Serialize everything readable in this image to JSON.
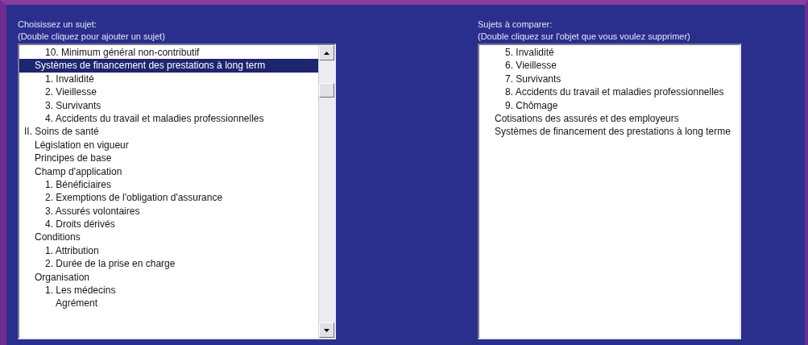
{
  "panels": [
    {
      "title": "Choisissez un sujet:",
      "hint": "(Double cliquez pour ajouter un sujet)",
      "scrollbar": true,
      "items": [
        {
          "children": [
            {
              "children": [
                {
                  "label": "10. Minimum général non-contributif",
                  "selected": false
                }
              ]
            },
            {
              "label": "Systèmes de financement des prestations à long term",
              "selected": true,
              "children": [
                {
                  "label": "1. Invalidité",
                  "selected": false
                },
                {
                  "label": "2. Vieillesse",
                  "selected": false
                },
                {
                  "label": "3. Survivants",
                  "selected": false
                },
                {
                  "label": "4. Accidents du travail et maladies professionnelles",
                  "selected": false
                }
              ]
            }
          ]
        },
        {
          "label": "II. Soins de santé",
          "selected": false,
          "children": [
            {
              "label": "Législation en vigueur",
              "selected": false
            },
            {
              "label": "Principes de base",
              "selected": false
            },
            {
              "label": "Champ d'application",
              "selected": false,
              "children": [
                {
                  "label": "1. Bénéficiaires",
                  "selected": false
                },
                {
                  "label": "2. Exemptions de l'obligation d'assurance",
                  "selected": false
                },
                {
                  "label": "3. Assurés volontaires",
                  "selected": false
                },
                {
                  "label": "4. Droits dérivés",
                  "selected": false
                }
              ]
            },
            {
              "label": "Conditions",
              "selected": false,
              "children": [
                {
                  "label": "1. Attribution",
                  "selected": false
                },
                {
                  "label": "2. Durée de la prise en charge",
                  "selected": false
                }
              ]
            },
            {
              "label": "Organisation",
              "selected": false,
              "children": [
                {
                  "label": "1. Les médecins",
                  "selected": false,
                  "children": [
                    {
                      "label": "Agrément",
                      "selected": false
                    }
                  ]
                }
              ]
            }
          ]
        }
      ]
    },
    {
      "title": "Sujets à comparer:",
      "hint": "(Double cliquez sur l'objet que vous voulez supprimer)",
      "scrollbar": false,
      "items": [
        {
          "children": [
            {
              "children": [
                {
                  "label": "5. Invalidité",
                  "selected": false
                },
                {
                  "label": "6. Vieillesse",
                  "selected": false
                },
                {
                  "label": "7. Survivants",
                  "selected": false
                },
                {
                  "label": "8. Accidents du travail et maladies professionnelles",
                  "selected": false
                },
                {
                  "label": "9. Chômage",
                  "selected": false
                }
              ]
            },
            {
              "label": "Cotisations des assurés et des employeurs",
              "selected": false
            },
            {
              "label": "Systèmes de financement des prestations à long terme",
              "selected": false
            }
          ]
        }
      ]
    }
  ]
}
